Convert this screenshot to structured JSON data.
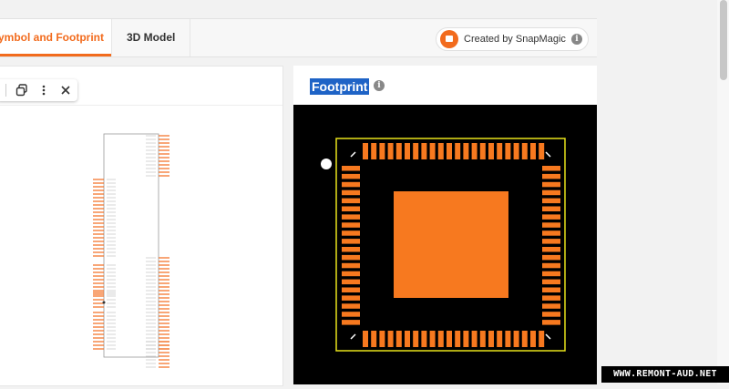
{
  "tabs": {
    "active_label": "Symbol and Footprint",
    "second_label": "3D Model"
  },
  "snapmagic": {
    "label": "Created by SnapMagic",
    "icon": "snapmagic-logo-icon",
    "info_icon": "info-icon"
  },
  "toolbar": {
    "icons": [
      "copy-icon",
      "more-vertical-icon",
      "close-icon"
    ]
  },
  "footprint": {
    "title": "Footprint",
    "info_icon": "info-icon",
    "colors": {
      "background": "#000000",
      "pad": "#f7791f",
      "outline": "#e7e21b",
      "pin1_marker": "#ffffff"
    }
  },
  "watermark": "WWW.REMONT-AUD.NET",
  "colors": {
    "accent": "#f26b1d",
    "selection": "#1e63c6"
  }
}
